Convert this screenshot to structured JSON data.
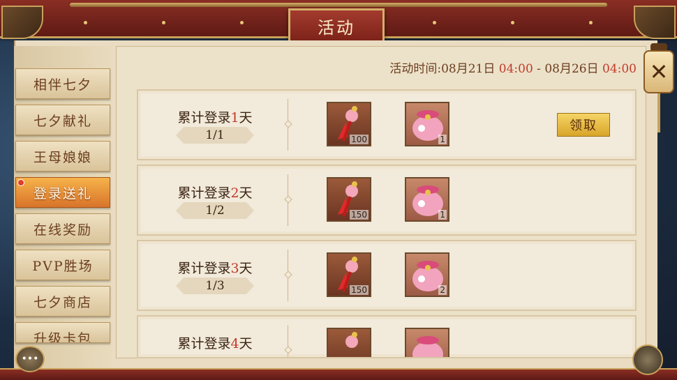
{
  "window": {
    "title": "活动",
    "close_icon": "close-icon"
  },
  "event_time": {
    "prefix": "活动时间:08月21日",
    "start_time": "04:00",
    "middle": " - 08月26日",
    "end_time": "04:00"
  },
  "sidebar": {
    "items": [
      {
        "label": "相伴七夕",
        "active": false
      },
      {
        "label": "七夕献礼",
        "active": false
      },
      {
        "label": "王母娘娘",
        "active": false
      },
      {
        "label": "登录送礼",
        "active": true
      },
      {
        "label": "在线奖励",
        "active": false
      },
      {
        "label": "PVP胜场",
        "active": false
      },
      {
        "label": "七夕商店",
        "active": false
      },
      {
        "label": "升级卡包",
        "active": false
      }
    ]
  },
  "rows": [
    {
      "pre": "累计登录",
      "num": "1",
      "post": "天",
      "progress": "1/1",
      "rewards": [
        {
          "icon": "tassel-ornament-icon",
          "count": "100"
        },
        {
          "icon": "lucky-bag-icon",
          "count": "1"
        }
      ],
      "claim_label": "领取"
    },
    {
      "pre": "累计登录",
      "num": "2",
      "post": "天",
      "progress": "1/2",
      "rewards": [
        {
          "icon": "tassel-ornament-icon",
          "count": "150"
        },
        {
          "icon": "lucky-bag-icon",
          "count": "1"
        }
      ]
    },
    {
      "pre": "累计登录",
      "num": "3",
      "post": "天",
      "progress": "1/3",
      "rewards": [
        {
          "icon": "tassel-ornament-icon",
          "count": "150"
        },
        {
          "icon": "lucky-bag-icon",
          "count": "2"
        }
      ]
    },
    {
      "pre": "累计登录",
      "num": "4",
      "post": "天",
      "progress": "",
      "rewards": [
        {
          "icon": "tassel-ornament-icon",
          "count": ""
        },
        {
          "icon": "lucky-bag-icon",
          "count": ""
        }
      ]
    }
  ],
  "colors": {
    "accent_red": "#c23a2a",
    "active_tab": "#e88a36",
    "claim_button": "#e9bd45"
  }
}
